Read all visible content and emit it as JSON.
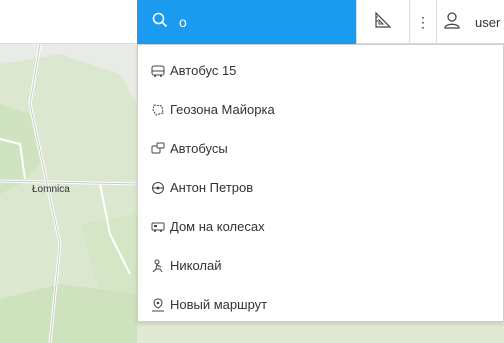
{
  "map": {
    "place_label": "Łomnica"
  },
  "search": {
    "value": "о"
  },
  "toolbar": {
    "more_glyph": "⋮",
    "user_label": "user"
  },
  "results": [
    {
      "icon": "bus-icon",
      "label": "Автобус 15"
    },
    {
      "icon": "geofence-icon",
      "label": "Геозона Майорка"
    },
    {
      "icon": "group-icon",
      "label": "Автобусы"
    },
    {
      "icon": "driver-icon",
      "label": "Антон Петров"
    },
    {
      "icon": "camper-icon",
      "label": "Дом на колесах"
    },
    {
      "icon": "person-icon",
      "label": "Николай"
    },
    {
      "icon": "route-icon",
      "label": "Новый маршрут"
    }
  ],
  "colors": {
    "accent": "#1a9bf0",
    "map_bg": "#e9ece6"
  }
}
